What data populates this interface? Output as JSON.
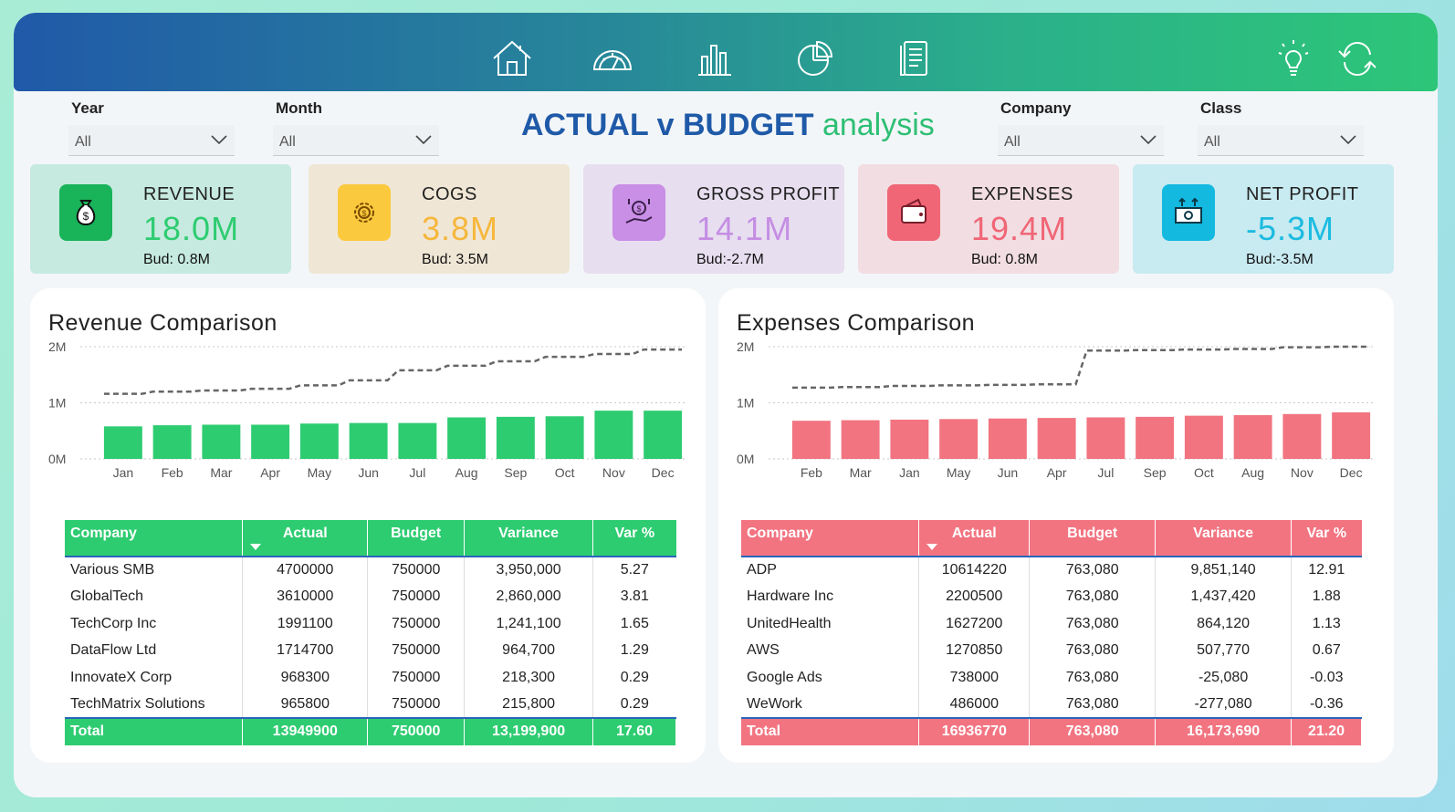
{
  "header": {
    "nav": [
      {
        "icon": "home-icon"
      },
      {
        "icon": "gauge-icon"
      },
      {
        "icon": "bar-chart-icon"
      },
      {
        "icon": "pie-chart-icon"
      },
      {
        "icon": "document-icon"
      }
    ],
    "right_icons": [
      {
        "icon": "lightbulb-icon"
      },
      {
        "icon": "refresh-icon"
      }
    ]
  },
  "filters": {
    "year": {
      "label": "Year",
      "value": "All"
    },
    "month": {
      "label": "Month",
      "value": "All"
    },
    "company": {
      "label": "Company",
      "value": "All"
    },
    "class": {
      "label": "Class",
      "value": "All"
    }
  },
  "title": {
    "bold": "ACTUAL v BUDGET",
    "light": "analysis"
  },
  "kpis": [
    {
      "label": "REVENUE",
      "value": "18.0M",
      "budget": "Bud: 0.8M",
      "color": "#2ecc71",
      "bg": "#c6eadf",
      "icon": "money-bag-icon",
      "icon_bg": "#19b35a"
    },
    {
      "label": "COGS",
      "value": "3.8M",
      "budget": "Bud: 3.5M",
      "color": "#f6b73c",
      "bg": "#efe6d5",
      "icon": "gear-icon",
      "icon_bg": "#fbc93d"
    },
    {
      "label": "GROSS PROFIT",
      "value": "14.1M",
      "budget": "Bud:-2.7M",
      "color": "#c58ee3",
      "bg": "#e7def0",
      "icon": "hand-profit-icon",
      "icon_bg": "#c98ee6"
    },
    {
      "label": "EXPENSES",
      "value": "19.4M",
      "budget": "Bud: 0.8M",
      "color": "#f06676",
      "bg": "#f1dde2",
      "icon": "wallet-icon",
      "icon_bg": "#f06676"
    },
    {
      "label": "NET PROFIT",
      "value": "-5.3M",
      "budget": "Bud:-3.5M",
      "color": "#1bbbe0",
      "bg": "#c8eaf1",
      "icon": "cash-icon",
      "icon_bg": "#14b9e0"
    }
  ],
  "revenue": {
    "title": "Revenue Comparison",
    "table": {
      "headers": [
        "Company",
        "Actual",
        "Budget",
        "Variance",
        "Var %"
      ],
      "rows": [
        [
          "Various SMB",
          "4700000",
          "750000",
          "3,950,000",
          "5.27"
        ],
        [
          "GlobalTech",
          "3610000",
          "750000",
          "2,860,000",
          "3.81"
        ],
        [
          "TechCorp Inc",
          "1991100",
          "750000",
          "1,241,100",
          "1.65"
        ],
        [
          "DataFlow Ltd",
          "1714700",
          "750000",
          "964,700",
          "1.29"
        ],
        [
          "InnovateX Corp",
          "968300",
          "750000",
          "218,300",
          "0.29"
        ],
        [
          "TechMatrix Solutions",
          "965800",
          "750000",
          "215,800",
          "0.29"
        ]
      ],
      "total": [
        "Total",
        "13949900",
        "750000",
        "13,199,900",
        "17.60"
      ]
    }
  },
  "expenses": {
    "title": "Expenses Comparison",
    "table": {
      "headers": [
        "Company",
        "Actual",
        "Budget",
        "Variance",
        "Var %"
      ],
      "rows": [
        [
          "ADP",
          "10614220",
          "763,080",
          "9,851,140",
          "12.91"
        ],
        [
          "Hardware Inc",
          "2200500",
          "763,080",
          "1,437,420",
          "1.88"
        ],
        [
          "UnitedHealth",
          "1627200",
          "763,080",
          "864,120",
          "1.13"
        ],
        [
          "AWS",
          "1270850",
          "763,080",
          "507,770",
          "0.67"
        ],
        [
          "Google Ads",
          "738000",
          "763,080",
          "-25,080",
          "-0.03"
        ],
        [
          "WeWork",
          "486000",
          "763,080",
          "-277,080",
          "-0.36"
        ]
      ],
      "total": [
        "Total",
        "16936770",
        "763,080",
        "16,173,690",
        "21.20"
      ]
    }
  },
  "chart_data": [
    {
      "type": "bar",
      "categories": [
        "Jan",
        "Feb",
        "Mar",
        "Apr",
        "May",
        "Jun",
        "Jul",
        "Aug",
        "Sep",
        "Oct",
        "Nov",
        "Dec"
      ],
      "series": [
        {
          "values": [
            0.58,
            0.6,
            0.61,
            0.61,
            0.63,
            0.64,
            0.64,
            0.74,
            0.75,
            0.76,
            0.86,
            0.86
          ],
          "color": "#2ecc71"
        },
        {
          "values": [
            1.16,
            1.2,
            1.22,
            1.25,
            1.31,
            1.4,
            1.58,
            1.66,
            1.74,
            1.82,
            1.87,
            1.95
          ],
          "style": "dashed-step"
        }
      ],
      "yticks": [
        "0M",
        "1M",
        "2M"
      ],
      "ylim": [
        0,
        2
      ]
    },
    {
      "type": "bar",
      "categories": [
        "Feb",
        "Mar",
        "Jan",
        "May",
        "Jun",
        "Apr",
        "Jul",
        "Sep",
        "Oct",
        "Aug",
        "Nov",
        "Dec"
      ],
      "series": [
        {
          "values": [
            0.68,
            0.69,
            0.7,
            0.71,
            0.72,
            0.73,
            0.74,
            0.75,
            0.77,
            0.78,
            0.8,
            0.83
          ],
          "color": "#f27481"
        },
        {
          "values": [
            1.27,
            1.28,
            1.3,
            1.31,
            1.32,
            1.33,
            1.93,
            1.94,
            1.95,
            1.96,
            1.99,
            2.0
          ],
          "style": "dashed-step"
        }
      ],
      "yticks": [
        "0M",
        "1M",
        "2M"
      ],
      "ylim": [
        0,
        2
      ]
    }
  ]
}
